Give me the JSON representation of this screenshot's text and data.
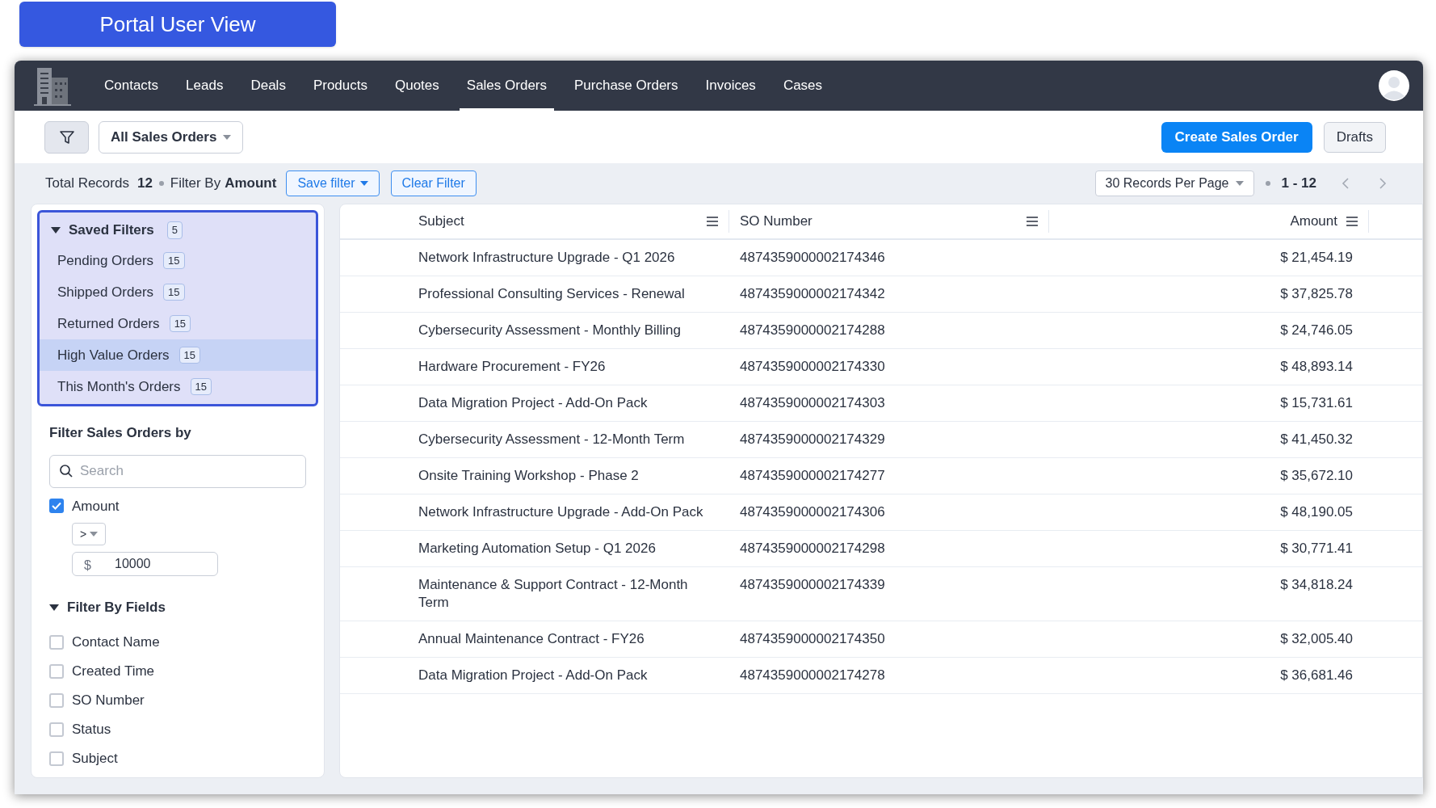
{
  "view_button": "Portal User View",
  "nav": {
    "tabs": [
      {
        "label": "Contacts",
        "selected": false
      },
      {
        "label": "Leads",
        "selected": false
      },
      {
        "label": "Deals",
        "selected": false
      },
      {
        "label": "Products",
        "selected": false
      },
      {
        "label": "Quotes",
        "selected": false
      },
      {
        "label": "Sales Orders",
        "selected": true
      },
      {
        "label": "Purchase Orders",
        "selected": false
      },
      {
        "label": "Invoices",
        "selected": false
      },
      {
        "label": "Cases",
        "selected": false
      }
    ]
  },
  "toolbar": {
    "view_select": "All Sales Orders",
    "create_button": "Create Sales Order",
    "drafts_button": "Drafts"
  },
  "filter_bar": {
    "total_label": "Total Records",
    "total": "12",
    "filter_label": "Filter By",
    "filter_field": "Amount",
    "save_filter": "Save filter",
    "clear_filter": "Clear Filter",
    "per_page": "30 Records Per Page",
    "range": "1 - 12"
  },
  "sidebar": {
    "saved_filters": {
      "title": "Saved Filters",
      "count": "5",
      "expanded": true,
      "items": [
        {
          "label": "Pending Orders",
          "count": "15",
          "selected": false
        },
        {
          "label": "Shipped Orders",
          "count": "15",
          "selected": false
        },
        {
          "label": "Returned Orders",
          "count": "15",
          "selected": false
        },
        {
          "label": "High Value Orders",
          "count": "15",
          "selected": true
        },
        {
          "label": "This Month's Orders",
          "count": "15",
          "selected": false
        }
      ]
    },
    "filter_title": "Filter Sales Orders by",
    "search": {
      "placeholder": "Search"
    },
    "amount_filter": {
      "label": "Amount",
      "checked": true,
      "operator": ">",
      "currency": "$",
      "value": "10000"
    },
    "fields": {
      "title": "Filter By Fields",
      "expanded": true,
      "items": [
        {
          "label": "Contact Name",
          "checked": false
        },
        {
          "label": "Created Time",
          "checked": false
        },
        {
          "label": "SO Number",
          "checked": false
        },
        {
          "label": "Status",
          "checked": false
        },
        {
          "label": "Subject",
          "checked": false
        }
      ]
    }
  },
  "table": {
    "columns": [
      "Subject",
      "SO Number",
      "Amount"
    ],
    "rows": [
      [
        "Network Infrastructure Upgrade - Q1 2026",
        "4874359000002174346",
        "$ 21,454.19"
      ],
      [
        "Professional Consulting Services - Renewal",
        "4874359000002174342",
        "$ 37,825.78"
      ],
      [
        "Cybersecurity Assessment - Monthly Billing",
        "4874359000002174288",
        "$ 24,746.05"
      ],
      [
        "Hardware Procurement - FY26",
        "4874359000002174330",
        "$ 48,893.14"
      ],
      [
        "Data Migration Project - Add-On Pack",
        "4874359000002174303",
        "$ 15,731.61"
      ],
      [
        "Cybersecurity Assessment - 12-Month Term",
        "4874359000002174329",
        "$ 41,450.32"
      ],
      [
        "Onsite Training Workshop - Phase 2",
        "4874359000002174277",
        "$ 35,672.10"
      ],
      [
        "Network Infrastructure Upgrade - Add-On Pack",
        "4874359000002174306",
        "$ 48,190.05"
      ],
      [
        "Marketing Automation Setup - Q1 2026",
        "4874359000002174298",
        "$ 30,771.41"
      ],
      [
        "Maintenance & Support Contract - 12-Month Term",
        "4874359000002174339",
        "$ 34,818.24"
      ],
      [
        "Annual Maintenance Contract - FY26",
        "4874359000002174350",
        "$ 32,005.40"
      ],
      [
        "Data Migration Project - Add-On Pack",
        "4874359000002174278",
        "$ 36,681.46"
      ]
    ]
  }
}
